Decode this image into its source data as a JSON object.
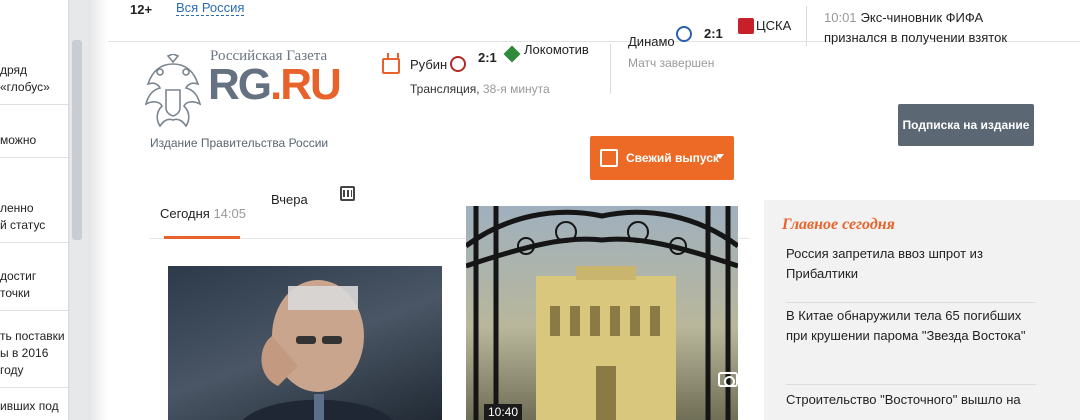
{
  "left_sidebar": {
    "items": [
      "дряд\n«глобус»",
      "можно",
      "ленно\nй статус",
      "достиг точки",
      "ть поставки\nы в 2016 году",
      "ивших под"
    ]
  },
  "topbar": {
    "age": "12+",
    "region": "Вся Россия"
  },
  "logo": {
    "small_title": "Российская Газета",
    "rg": "RG",
    "dot": ".",
    "ru": "RU",
    "tagline": "Издание Правительства России"
  },
  "scores": {
    "match1": {
      "home": "Рубин",
      "score": "2:1",
      "away": "Локомотив",
      "status": "Трансляция,",
      "minute": "38-я минута"
    },
    "match2": {
      "home": "Динамо",
      "score": "2:1",
      "away": "ЦСКА",
      "status": "Матч завершен"
    }
  },
  "news_flash": {
    "time": "10:01",
    "line1": "Экс-чиновник ФИФА",
    "line2": "признался в получении взяток"
  },
  "buttons": {
    "subscribe": "Подписка на издание",
    "fresh_issue": "Свежий выпуск"
  },
  "tabs": {
    "today": "Сегодня",
    "today_time": "14:05",
    "yesterday": "Вчера"
  },
  "photos": {
    "time_badge": "10:40"
  },
  "main_today": {
    "heading": "Главное сегодня",
    "items": [
      "Россия запретила ввоз шпрот из Прибалтики",
      "В Китае обнаружили тела 65 погибших при крушении парома \"Звезда Востока\"",
      "Строительство \"Восточного\" вышло на"
    ]
  },
  "colors": {
    "accent": "#e8632b",
    "slate": "#5b6773"
  }
}
